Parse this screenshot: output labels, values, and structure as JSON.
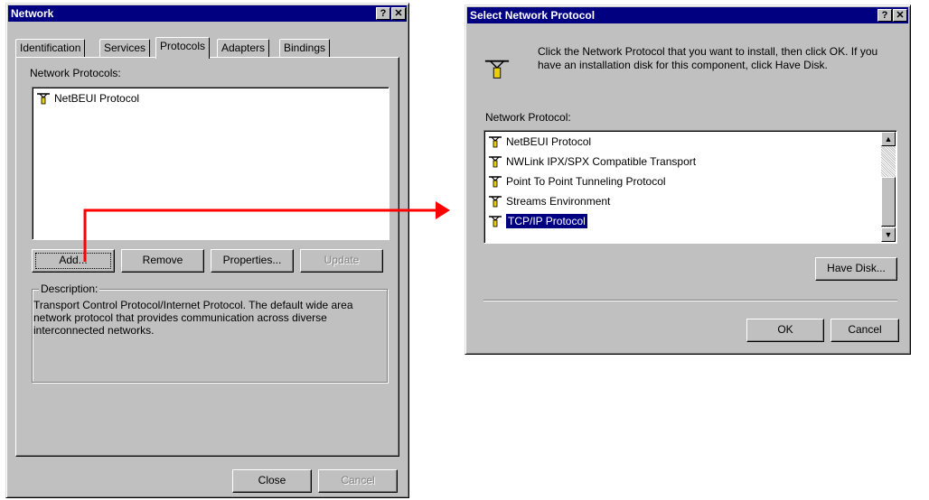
{
  "network": {
    "title": "Network",
    "help_btn": "?",
    "close_btn": "✕",
    "tabs": [
      "Identification",
      "Services",
      "Protocols",
      "Adapters",
      "Bindings"
    ],
    "protocols_label": "Network Protocols:",
    "protocols": [
      "NetBEUI Protocol"
    ],
    "buttons": {
      "add": "Add...",
      "remove": "Remove",
      "properties": "Properties...",
      "update": "Update"
    },
    "description_label": "Description:",
    "description_text": "Transport Control Protocol/Internet Protocol. The default wide area network protocol that provides communication across diverse interconnected networks.",
    "close_label": "Close",
    "cancel_label": "Cancel"
  },
  "select": {
    "title": "Select Network Protocol",
    "help_btn": "?",
    "close_btn": "✕",
    "instruction": "Click the Network Protocol that you want to install, then click OK.  If you have an installation disk for this component, click Have Disk.",
    "list_label": "Network Protocol:",
    "protocols": [
      "NetBEUI Protocol",
      "NWLink IPX/SPX Compatible Transport",
      "Point To Point Tunneling Protocol",
      "Streams Environment",
      "TCP/IP Protocol"
    ],
    "selected_index": 4,
    "have_disk_label": "Have Disk...",
    "ok_label": "OK",
    "cancel_label": "Cancel"
  },
  "colors": {
    "title_bar": "#000080",
    "dialog_face": "#c0c0c0",
    "arrow": "#ff0000"
  }
}
